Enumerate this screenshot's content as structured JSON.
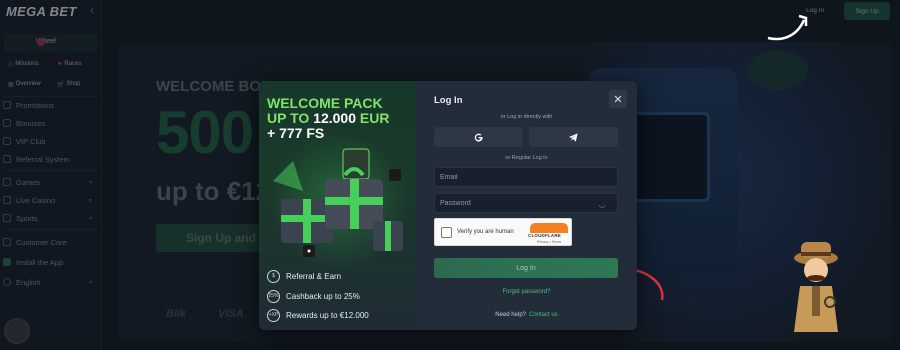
{
  "brand": {
    "logo_text": "MEGA BET",
    "accent": "#2fa85d",
    "button_green": "#2e7856",
    "link_green": "#4fbf7e"
  },
  "sidebar": {
    "wheel_label": "Wheel",
    "tiles": [
      {
        "label": "Missions",
        "icon": "target-icon"
      },
      {
        "label": "Races",
        "icon": "flag-icon"
      },
      {
        "label": "Overview",
        "icon": "chart-icon"
      },
      {
        "label": "Shop",
        "icon": "cart-icon"
      }
    ],
    "items": [
      {
        "label": "Promotions",
        "icon": "gift-icon"
      },
      {
        "label": "Bonuses",
        "icon": "ticket-icon"
      },
      {
        "label": "VIP Club",
        "icon": "crown-icon"
      },
      {
        "label": "Referral System",
        "icon": "users-icon"
      },
      {
        "label": "Games",
        "icon": "gamepad-icon"
      },
      {
        "label": "Live Casino",
        "icon": "cards-icon"
      },
      {
        "label": "Sports",
        "icon": "ball-icon"
      },
      {
        "label": "Customer Care",
        "icon": "headset-icon"
      },
      {
        "label": "Install the App",
        "icon": "download-icon"
      },
      {
        "label": "English",
        "icon": "globe-icon"
      }
    ]
  },
  "topbar": {
    "login_label": "Log In",
    "signup_label": "Sign Up"
  },
  "hero": {
    "welcome": "WELCOME BONU",
    "amount": "500",
    "upto": "up to €12",
    "cta": "Sign Up and",
    "payments": [
      "Blik",
      "VISA"
    ]
  },
  "modal": {
    "promo": {
      "line1": "WELCOME PACK",
      "line2_prefix": "UP TO",
      "line2_amount": "12.000",
      "line2_suffix": "EUR",
      "line3": "+ 777 FS",
      "perks": [
        {
          "label": "Referral & Earn",
          "icon": "hand-coin-icon",
          "badge": ""
        },
        {
          "label": "Cashback up to 25%",
          "icon": "percent-icon",
          "badge": "25%"
        },
        {
          "label": "Rewards up to €12.000",
          "icon": "xp-icon",
          "badge": "+XP"
        }
      ]
    },
    "form": {
      "title": "Log In",
      "direct_label": "or Log in directly with",
      "regular_label": "or Regular Log in",
      "email_placeholder": "Email",
      "password_placeholder": "Password",
      "captcha_text": "Verify you are human",
      "captcha_brand": "CLOUDFLARE",
      "captcha_links": "Privacy • Terms",
      "login_button": "Log In",
      "forgot": "Forgot password?",
      "help_text": "Need help?",
      "help_link": "Contact us"
    }
  }
}
